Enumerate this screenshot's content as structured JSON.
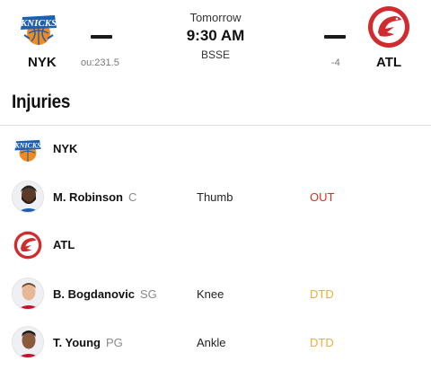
{
  "game": {
    "away_team": {
      "abbr": "NYK",
      "odds": "ou:231.5"
    },
    "home_team": {
      "abbr": "ATL",
      "odds": "-4"
    },
    "day": "Tomorrow",
    "time": "9:30 AM",
    "network": "BSSE"
  },
  "injuries": {
    "title": "Injuries",
    "teams": [
      {
        "abbr": "NYK",
        "players": [
          {
            "name": "M. Robinson",
            "position": "C",
            "injury": "Thumb",
            "status": "OUT",
            "status_color": "#d93025"
          }
        ]
      },
      {
        "abbr": "ATL",
        "players": [
          {
            "name": "B. Bogdanovic",
            "position": "SG",
            "injury": "Knee",
            "status": "DTD",
            "status_color": "#e8b22e"
          },
          {
            "name": "T. Young",
            "position": "PG",
            "injury": "Ankle",
            "status": "DTD",
            "status_color": "#e8b22e"
          }
        ]
      }
    ]
  },
  "colors": {
    "knicks_blue": "#1d5fb0",
    "knicks_orange": "#f28a1f",
    "hawks_red": "#d12a2f"
  }
}
